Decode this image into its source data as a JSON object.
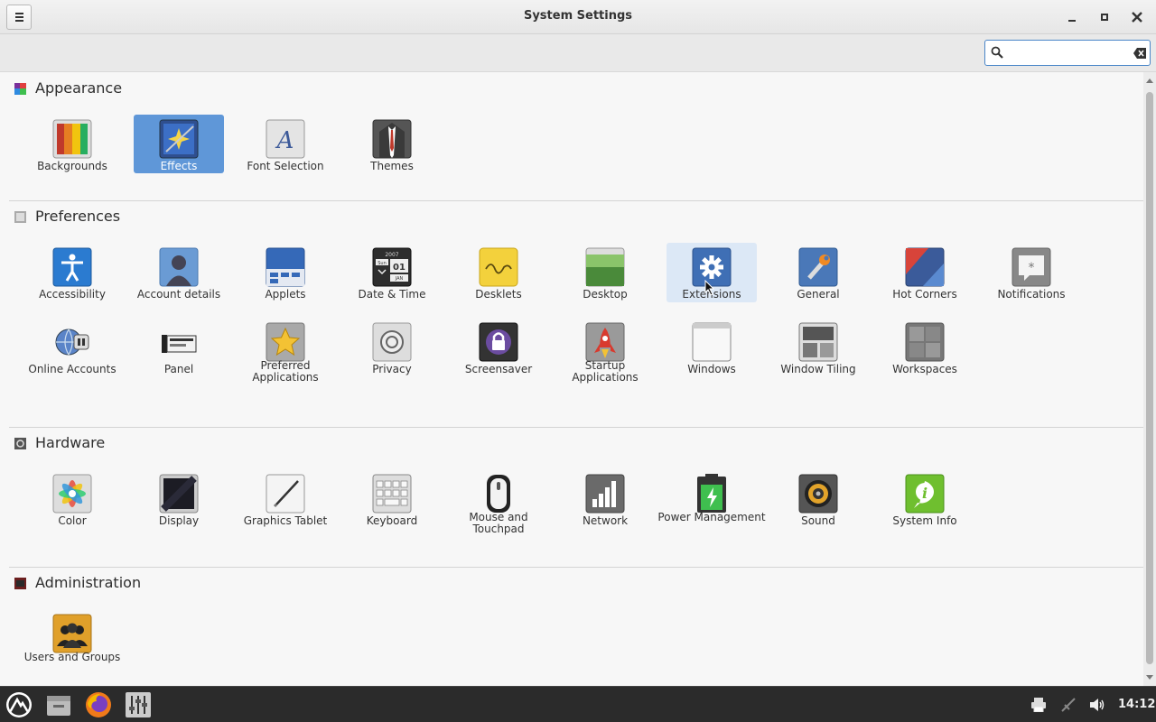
{
  "window": {
    "title": "System Settings"
  },
  "search": {
    "value": "",
    "placeholder": ""
  },
  "sections": [
    {
      "title": "Appearance",
      "items": [
        "Backgrounds",
        "Effects",
        "Font Selection",
        "Themes"
      ]
    },
    {
      "title": "Preferences",
      "items": [
        "Accessibility",
        "Account details",
        "Applets",
        "Date & Time",
        "Desklets",
        "Desktop",
        "Extensions",
        "General",
        "Hot Corners",
        "Notifications",
        "Online Accounts",
        "Panel",
        "Preferred Applications",
        "Privacy",
        "Screensaver",
        "Startup Applications",
        "Windows",
        "Window Tiling",
        "Workspaces"
      ]
    },
    {
      "title": "Hardware",
      "items": [
        "Color",
        "Display",
        "Graphics Tablet",
        "Keyboard",
        "Mouse and Touchpad",
        "Network",
        "Power Management",
        "Sound",
        "System Info"
      ]
    },
    {
      "title": "Administration",
      "items": [
        "Users and Groups"
      ]
    }
  ],
  "selected_item": "Effects",
  "hovered_item": "Extensions",
  "date_icon": {
    "year": "2007",
    "weekday": "Sun",
    "day": "01",
    "month": "JAN"
  },
  "taskbar": {
    "clock": "14:12"
  },
  "colors": {
    "selection": "#5f97d8",
    "hover": "#dce8f6",
    "taskbar": "#2b2b2b"
  }
}
